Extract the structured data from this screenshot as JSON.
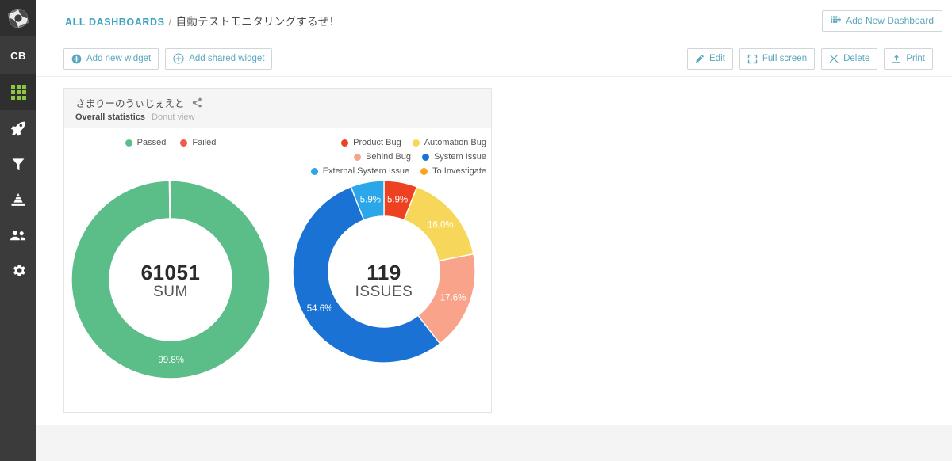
{
  "sidebar": {
    "logo_icon": "aperture-logo-icon",
    "user_initials": "CB",
    "items": [
      {
        "name": "dashboards",
        "icon": "grid-icon",
        "active": true
      },
      {
        "name": "launches",
        "icon": "rocket-icon",
        "active": false
      },
      {
        "name": "filters",
        "icon": "funnel-icon",
        "active": false
      },
      {
        "name": "debug",
        "icon": "traffic-cone-icon",
        "active": false
      },
      {
        "name": "members",
        "icon": "members-icon",
        "active": false
      },
      {
        "name": "settings",
        "icon": "gear-icon",
        "active": false
      }
    ]
  },
  "header": {
    "breadcrumb_root": "ALL DASHBOARDS",
    "breadcrumb_separator": "/",
    "breadcrumb_current": "自動テストモニタリングするぜ！",
    "add_new_dashboard": "Add New Dashboard",
    "add_new_dashboard_icon": "grid-plus-icon"
  },
  "toolbar": {
    "add_new_widget": "Add new widget",
    "add_new_widget_icon": "plus-circle-filled-icon",
    "add_shared_widget": "Add shared widget",
    "add_shared_widget_icon": "plus-circle-outline-icon",
    "edit": "Edit",
    "edit_icon": "pencil-icon",
    "full_screen": "Full screen",
    "full_screen_icon": "expand-icon",
    "delete": "Delete",
    "delete_icon": "close-x-icon",
    "print": "Print",
    "print_icon": "upload-arrow-icon"
  },
  "widget": {
    "title": "さまりーのうぃじぇえと",
    "share_icon": "share-icon",
    "subtitle_strong": "Overall statistics",
    "subtitle_muted": "Donut view"
  },
  "colors": {
    "accent": "#5aa7bd",
    "passed": "#5bbd87",
    "failed": "#ef5b4c",
    "product_bug": "#ee4122",
    "automation_bug": "#f7d759",
    "behind_bug": "#f9a48a",
    "system_issue": "#1a73d4",
    "external_system_issue": "#2ba6e8",
    "to_investigate": "#f5a623",
    "sidebar_bg": "#3b3b3b",
    "sidebar_active": "#2f2f2f",
    "nav_icon_active": "#8dc63f"
  },
  "chart_data": [
    {
      "type": "pie",
      "title": "Overall statistics",
      "center_value": "61051",
      "center_label": "SUM",
      "legend_position": "top",
      "labels": [
        "Passed",
        "Failed"
      ],
      "colors": [
        "#5bbd87",
        "#ef5b4c"
      ],
      "values": [
        99.8,
        0.2
      ],
      "value_labels": [
        "99.8%",
        ""
      ],
      "shown_value_labels": [
        {
          "text": "99.8%",
          "index": 0
        }
      ]
    },
    {
      "type": "pie",
      "title": "Defect types",
      "center_value": "119",
      "center_label": "ISSUES",
      "legend_position": "top",
      "labels": [
        "Product Bug",
        "Automation Bug",
        "Behind Bug",
        "System Issue",
        "External System Issue",
        "To Investigate"
      ],
      "colors": [
        "#ee4122",
        "#f7d759",
        "#f9a48a",
        "#1a73d4",
        "#2ba6e8",
        "#f5a623"
      ],
      "values": [
        5.9,
        16.0,
        17.6,
        54.6,
        5.9,
        0
      ],
      "value_labels": [
        "5.9%",
        "16.0%",
        "17.6%",
        "54.6%",
        "5.9%",
        ""
      ]
    }
  ]
}
